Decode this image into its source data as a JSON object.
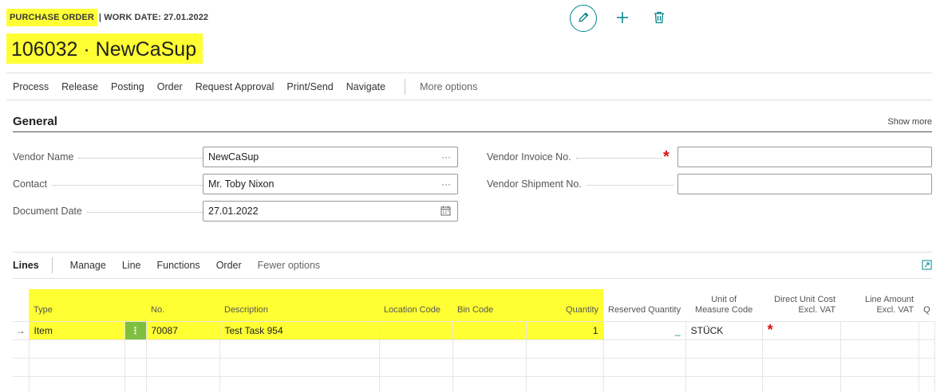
{
  "header": {
    "page_caption": "PURCHASE ORDER",
    "work_date": "| WORK DATE: 27.01.2022",
    "record_title": "106032 · NewCaSup",
    "icons": [
      "edit-icon",
      "plus-icon",
      "trash-icon"
    ]
  },
  "actions": {
    "items": [
      "Process",
      "Release",
      "Posting",
      "Order",
      "Request Approval",
      "Print/Send",
      "Navigate"
    ],
    "more": "More options"
  },
  "general": {
    "title": "General",
    "show_more": "Show more",
    "vendor_name_label": "Vendor Name",
    "vendor_name": "NewCaSup",
    "contact_label": "Contact",
    "contact": "Mr. Toby Nixon",
    "document_date_label": "Document Date",
    "document_date": "27.01.2022",
    "vendor_invoice_label": "Vendor Invoice No.",
    "vendor_invoice": "",
    "vendor_shipment_label": "Vendor Shipment No.",
    "vendor_shipment": "",
    "ellipsis": "···",
    "required_mark": "*"
  },
  "lines": {
    "tab": "Lines",
    "items": [
      "Manage",
      "Line",
      "Functions",
      "Order"
    ],
    "fewer": "Fewer options",
    "columns": {
      "type": "Type",
      "no": "No.",
      "description": "Description",
      "location": "Location Code",
      "bin": "Bin Code",
      "quantity": "Quantity",
      "reserved": "Reserved Quantity",
      "uom_1": "Unit of",
      "uom_2": "Measure Code",
      "unit_cost_1": "Direct Unit Cost",
      "unit_cost_2": "Excl. VAT",
      "line_amount_1": "Line Amount",
      "line_amount_2": "Excl. VAT",
      "q": "Q"
    },
    "row": {
      "arrow": "→",
      "type": "Item",
      "menu": "⋮",
      "no": "70087",
      "description": "Test Task 954",
      "location": "",
      "bin": "",
      "quantity": "1",
      "reserved": "_",
      "uom": "STÜCK",
      "unit_cost_mark": "*"
    }
  },
  "colors": {
    "accent": "#008489",
    "highlight": "#ffff33",
    "required": "#d61010",
    "row_menu": "#7fbf3f"
  }
}
